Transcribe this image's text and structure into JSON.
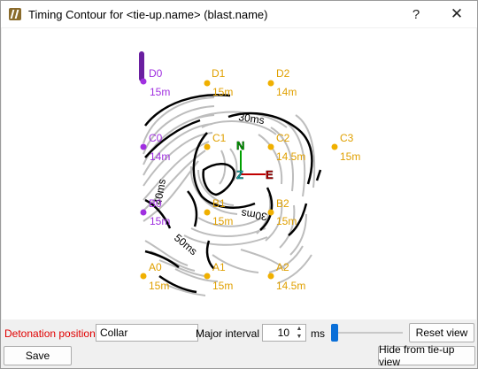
{
  "window": {
    "title": "Timing Contour for <tie-up.name> (blast.name)"
  },
  "titlebar": {
    "help_label": "?",
    "close_label": "✕"
  },
  "plot": {
    "colors": {
      "hole_orange": "#f0b000",
      "hole_purple": "#a030e0",
      "major_contour": "#000000",
      "minor_contour": "#bdbdbd",
      "axis_north": "#00a000",
      "axis_east": "#c00000",
      "axis_z": "#20b0b0"
    },
    "holes": [
      {
        "name": "D0",
        "depth": "15m",
        "color": "purple"
      },
      {
        "name": "D1",
        "depth": "15m",
        "color": "orange"
      },
      {
        "name": "D2",
        "depth": "14m",
        "color": "orange"
      },
      {
        "name": "C0",
        "depth": "14m",
        "color": "purple"
      },
      {
        "name": "C1",
        "depth": "",
        "color": "orange"
      },
      {
        "name": "C2",
        "depth": "14.5m",
        "color": "orange"
      },
      {
        "name": "C3",
        "depth": "15m",
        "color": "orange"
      },
      {
        "name": "B0",
        "depth": "15m",
        "color": "purple"
      },
      {
        "name": "B1",
        "depth": "15m",
        "color": "orange"
      },
      {
        "name": "B2",
        "depth": "15m",
        "color": "orange"
      },
      {
        "name": "A0",
        "depth": "15m",
        "color": "orange"
      },
      {
        "name": "A1",
        "depth": "15m",
        "color": "orange"
      },
      {
        "name": "A2",
        "depth": "14.5m",
        "color": "orange"
      }
    ],
    "contour_labels": [
      "30ms",
      "40ms",
      "30ms",
      "50ms"
    ],
    "axes": {
      "north": "N",
      "east": "E",
      "z": "Z"
    }
  },
  "controls": {
    "detonation_label": "Detonation position",
    "detonation_value": "Collar",
    "major_interval_label": "Major interval",
    "major_interval_value": "10",
    "ms_label": "ms",
    "slider_level": 0.0,
    "reset_view_label": "Reset view",
    "save_label": "Save",
    "hide_label": "Hide from tie-up view"
  }
}
